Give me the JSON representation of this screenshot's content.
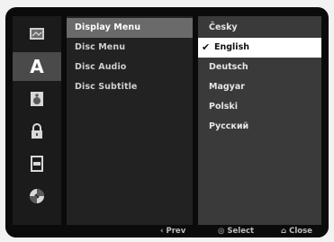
{
  "sidebar": {
    "items": [
      {
        "icon": "disc-menu-icon"
      },
      {
        "icon": "language-icon",
        "label": "A"
      },
      {
        "icon": "audio-icon"
      },
      {
        "icon": "lock-icon"
      },
      {
        "icon": "film-icon"
      },
      {
        "icon": "others-icon"
      }
    ]
  },
  "options": {
    "items": [
      {
        "label": "Display Menu"
      },
      {
        "label": "Disc Menu"
      },
      {
        "label": "Disc Audio"
      },
      {
        "label": "Disc Subtitle"
      }
    ]
  },
  "languages": {
    "items": [
      {
        "label": "Česky"
      },
      {
        "label": "English",
        "checked": true
      },
      {
        "label": "Deutsch"
      },
      {
        "label": "Magyar"
      },
      {
        "label": "Polski"
      },
      {
        "label": "Русский"
      }
    ]
  },
  "footer": {
    "prev": {
      "glyph": "‹",
      "label": "Prev"
    },
    "select": {
      "glyph": "◎",
      "label": "Select"
    },
    "close": {
      "glyph": "⌂",
      "label": "Close"
    }
  },
  "colors": {
    "highlight": "#6a6a6a",
    "selected_bg": "#ffffff",
    "active_icon": "#4a4a4a"
  }
}
